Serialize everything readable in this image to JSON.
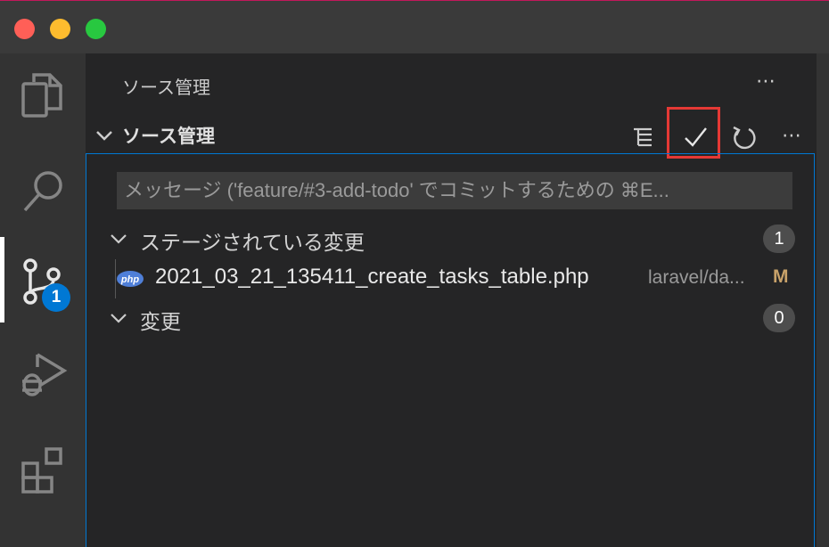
{
  "sidebar": {
    "title": "ソース管理",
    "more_label": "⋯"
  },
  "section": {
    "title": "ソース管理",
    "more_label": "⋯"
  },
  "commit_box": {
    "placeholder": "メッセージ ('feature/#3-add-todo' でコミットするための ⌘E..."
  },
  "activity_bar": {
    "scm_badge": "1"
  },
  "staged_group": {
    "label": "ステージされている変更",
    "count": "1",
    "files": [
      {
        "icon": "php-icon",
        "icon_text": "php",
        "name": "2021_03_21_135411_create_tasks_table.php",
        "path": "laravel/da...",
        "status": "M"
      }
    ]
  },
  "changes_group": {
    "label": "変更",
    "count": "0"
  },
  "colors": {
    "accent": "#0078d4",
    "highlight": "#e53935",
    "modified": "#c8a26a"
  }
}
